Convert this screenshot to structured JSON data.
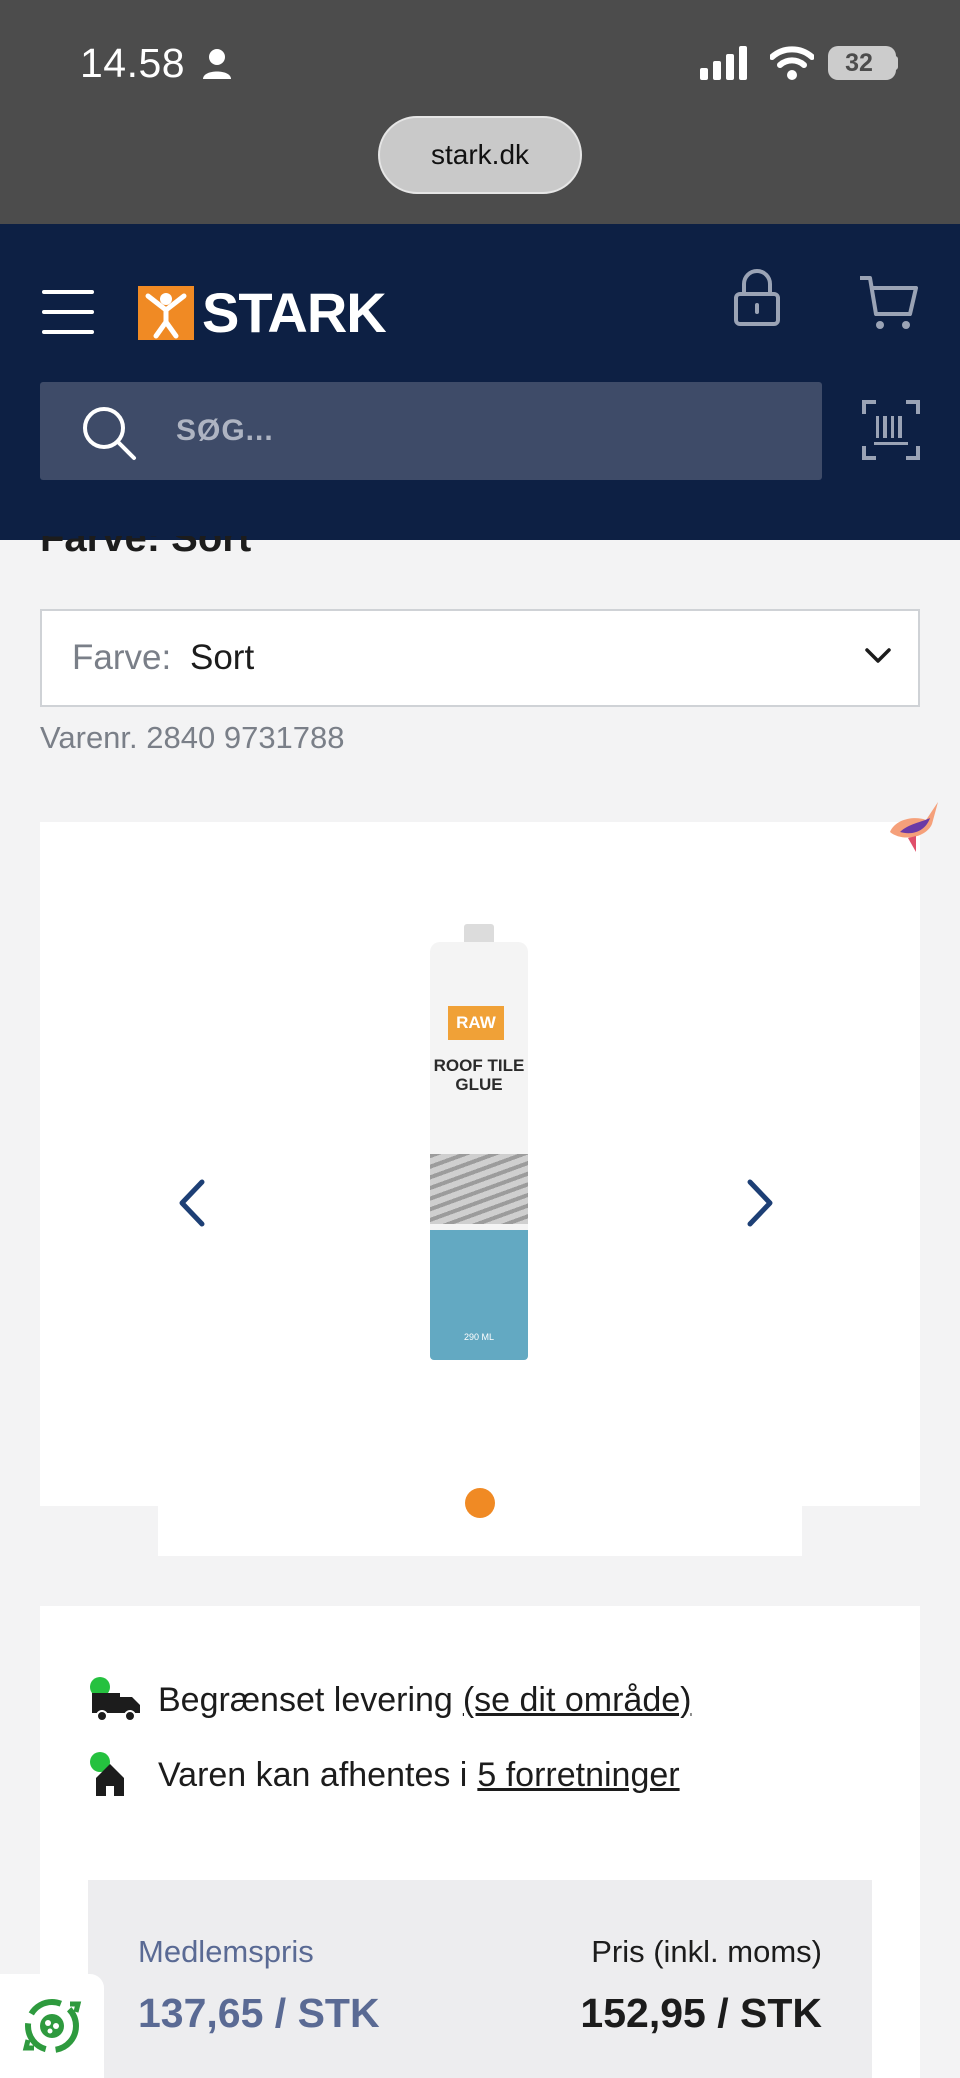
{
  "status_bar": {
    "time": "14.58",
    "battery": "32"
  },
  "browser": {
    "url": "stark.dk"
  },
  "header": {
    "logo_text": "STARK",
    "search_placeholder": "SØG..."
  },
  "product": {
    "color_heading_partial": "Farve: Sort",
    "color_select": {
      "label": "Farve:",
      "value": "Sort"
    },
    "item_number": "Varenr. 2840 9731788",
    "image": {
      "brand": "RAW",
      "name": "ROOF TILE GLUE",
      "volume": "290 ML"
    },
    "gallery": {
      "current_slide": 1,
      "total_slides": 1
    }
  },
  "delivery": [
    {
      "text": "Begrænset levering",
      "link": "(se dit område)",
      "icon": "truck-icon",
      "status_color": "#25c13f"
    },
    {
      "text": "Varen kan afhentes i",
      "link": "5 forretninger",
      "icon": "store-icon",
      "status_color": "#25c13f"
    }
  ],
  "pricing": {
    "member_label": "Medlemspris",
    "member_price": "137,65 / STK",
    "price_label": "Pris (inkl. moms)",
    "price": "152,95 / STK"
  },
  "colors": {
    "brand_navy": "#0d2044",
    "accent_orange": "#f08a24",
    "member_blue": "#5a6a94"
  }
}
